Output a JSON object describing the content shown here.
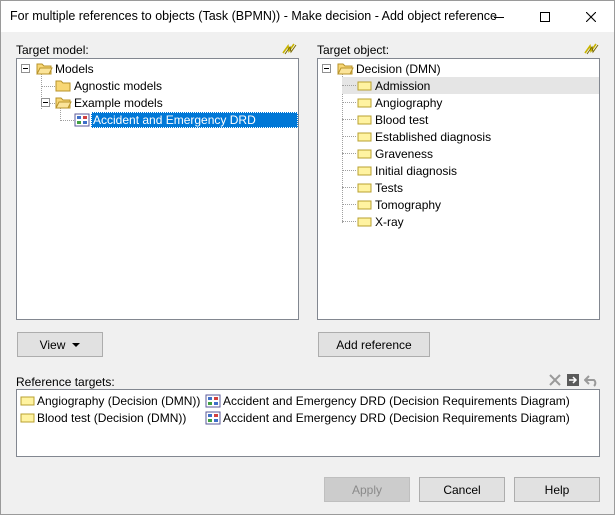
{
  "window": {
    "title": "For multiple references to objects (Task (BPMN)) - Make decision - Add object reference"
  },
  "target_model": {
    "label": "Target model:",
    "tree": [
      {
        "label": "Models",
        "icon": "folder-open-icon",
        "expanded": true
      },
      {
        "label": "Agnostic models",
        "icon": "folder-icon"
      },
      {
        "label": "Example models",
        "icon": "folder-open-icon",
        "expanded": true
      },
      {
        "label": "Accident and Emergency DRD",
        "icon": "drd-model-icon",
        "selected": true
      }
    ]
  },
  "target_object": {
    "label": "Target object:",
    "tree": [
      {
        "label": "Decision (DMN)",
        "icon": "folder-open-icon",
        "expanded": true
      },
      {
        "label": "Admission",
        "icon": "decision-icon",
        "highlighted": true
      },
      {
        "label": "Angiography",
        "icon": "decision-icon"
      },
      {
        "label": "Blood test",
        "icon": "decision-icon"
      },
      {
        "label": "Established diagnosis",
        "icon": "decision-icon"
      },
      {
        "label": "Graveness",
        "icon": "decision-icon"
      },
      {
        "label": "Initial diagnosis",
        "icon": "decision-icon"
      },
      {
        "label": "Tests",
        "icon": "decision-icon"
      },
      {
        "label": "Tomography",
        "icon": "decision-icon"
      },
      {
        "label": "X-ray",
        "icon": "decision-icon"
      }
    ]
  },
  "buttons": {
    "view": "View",
    "add_reference": "Add reference",
    "apply": "Apply",
    "cancel": "Cancel",
    "help": "Help"
  },
  "reference_targets": {
    "label": "Reference targets:",
    "rows": [
      {
        "object": "Angiography (Decision (DMN))",
        "model": "Accident and Emergency DRD (Decision Requirements Diagram)"
      },
      {
        "object": "Blood test (Decision (DMN))",
        "model": "Accident and Emergency DRD (Decision Requirements Diagram)"
      }
    ]
  },
  "colors": {
    "selection": "#0078d7",
    "folder": "#f8d775",
    "folder_border": "#c9a227",
    "decision_fill": "#fff3a1"
  }
}
